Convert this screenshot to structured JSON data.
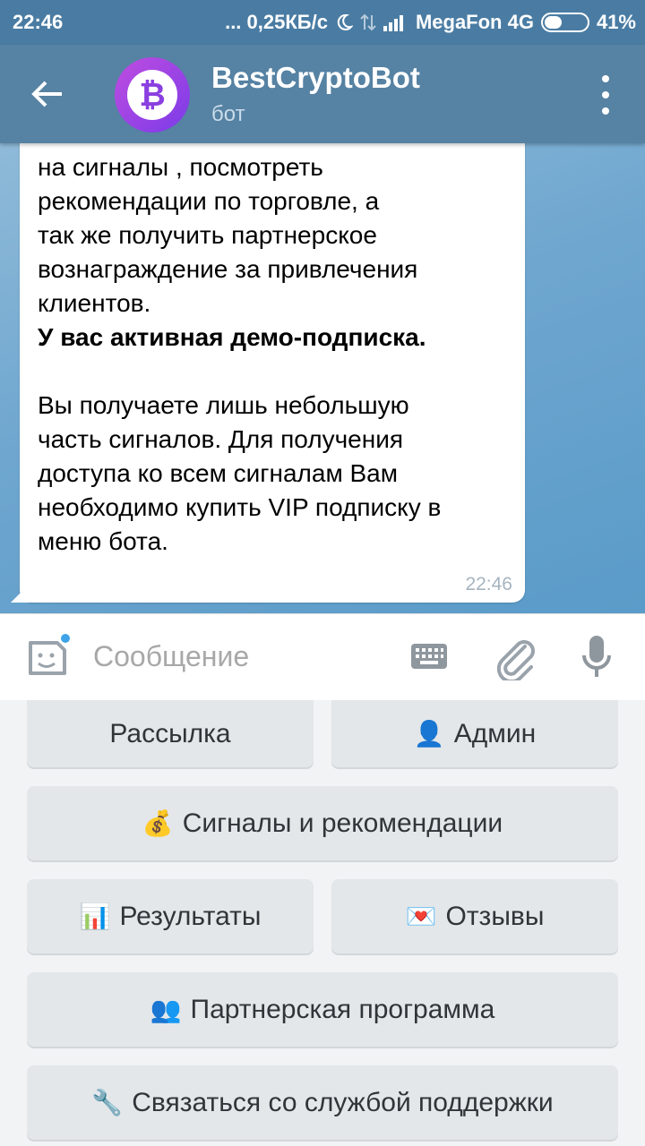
{
  "status_bar": {
    "time": "22:46",
    "network_speed": "... 0,25КБ/с",
    "carrier": "MegaFon 4G",
    "battery_percent": "41%",
    "battery_level": 0.41
  },
  "header": {
    "back_icon": "arrow-left-icon",
    "avatar_letter": "₿",
    "title": "BestCryptoBot",
    "subtitle": "бот",
    "menu_icon": "more-vertical-icon"
  },
  "message": {
    "text": "на сигналы , посмотреть\nрекомендации по торговле, а\nтак же получить партнерское\nвознаграждение за привлечения\nклиентов.",
    "bold_text": "У вас активная демо-подписка.",
    "text_2": "Вы получаете лишь небольшую\nчасть сигналов. Для получения\nдоступа ко всем сигналам Вам\nнеобходимо купить VIP подписку в\nменю бота.",
    "time": "22:46"
  },
  "input": {
    "placeholder": "Сообщение",
    "sticker_icon": "sticker-icon",
    "keyboard_icon": "keyboard-icon",
    "attach_icon": "paperclip-icon",
    "mic_icon": "microphone-icon"
  },
  "keyboard": {
    "buttons": [
      {
        "emoji": "",
        "label": "Рассылка"
      },
      {
        "emoji": "👤",
        "label": "Админ"
      },
      {
        "emoji": "💰",
        "label": "Сигналы и рекомендации"
      },
      {
        "emoji": "📊",
        "label": "Результаты"
      },
      {
        "emoji": "💌",
        "label": "Отзывы"
      },
      {
        "emoji": "👥",
        "label": "Партнерская программа"
      },
      {
        "emoji": "🔧",
        "label": "Связаться со службой поддержки"
      }
    ]
  }
}
